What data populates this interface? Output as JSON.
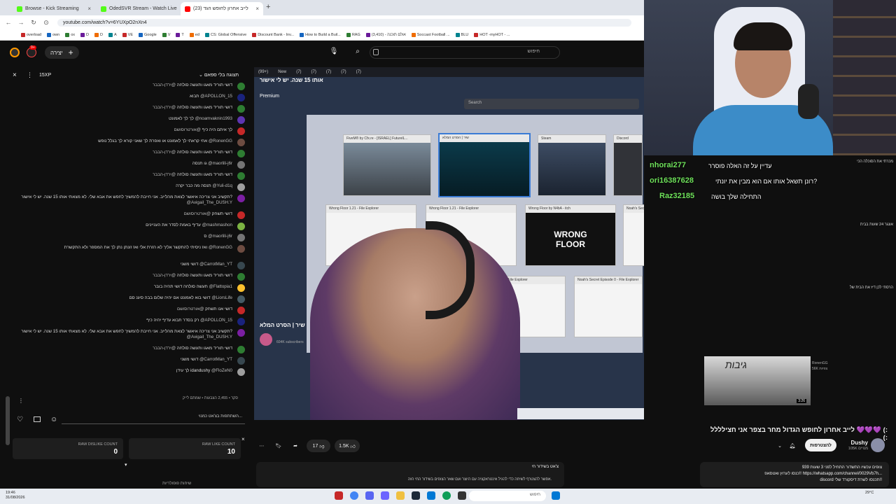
{
  "browser": {
    "tabs": [
      {
        "title": "Browse - Kick Streaming",
        "color": "#53fc18"
      },
      {
        "title": "OdedSVR Stream - Watch Live",
        "color": "#53fc18"
      },
      {
        "title": "לייב אחרון לחופש הגד (23)",
        "color": "#ff0000"
      }
    ],
    "new_tab": "+",
    "url": "youtube.com/watch?v=6YUXpO2nXn4",
    "bookmarks": [
      "overload",
      "own",
      "ox",
      "D",
      "D",
      "A",
      "VE",
      "Google",
      "V",
      "T",
      "ed",
      "CS: Global Offensive",
      "Discount Bank - Inv...",
      "How to Build a Buil...",
      "RAG",
      "(3,410) - אולם תוכנה",
      "Soccast Football ...",
      "BLU",
      "HOT -myHOT - ..."
    ]
  },
  "yt_header": {
    "create_label": "יצירה",
    "notif_count": "9+",
    "search_placeholder": "חיפוש"
  },
  "chat": {
    "header_title": "תצוגה בלי ספאם",
    "xp_badge": "15XP",
    "messages": [
      {
        "user": "@ירדן-הבבר",
        "text": "דושי תוריד מאגו ותעשה סולחה",
        "color": "#2e7d32"
      },
      {
        "user": "@APOLLON_15",
        "text": "תבוא",
        "color": "#1a237e"
      },
      {
        "user": "@ירדן-הבבר",
        "text": "דושי תוריד מאגו ותעשה סולחה",
        "color": "#2e7d32"
      },
      {
        "user": "@noamvaknin1993",
        "text": "לך לך לאמונט",
        "color": "#5e35b1"
      },
      {
        "user": "@אורטרוסושם",
        "text": "לך איתם היה כיף",
        "color": "#c62828"
      },
      {
        "user": "@RonenGG",
        "text": "אחי קראתי לך לאמונט או ואפרת לך שאני קורא לך בגלל נופש",
        "color": "#6d4c41"
      },
      {
        "user": "@ירדן-הבבר",
        "text": "דושי תוריד מאגו ותעשה סולחה",
        "color": "#2e7d32"
      },
      {
        "user": "@maorlili-j6r",
        "text": "גו תנסה",
        "color": "#757575"
      },
      {
        "user": "@ירדן-הבבר",
        "text": "דושי תוריד מאגו ותעשה סולחה",
        "color": "#2e7d32"
      },
      {
        "user": "@Yuli-d1q",
        "text": "תנסה מה כבר יקרה",
        "color": "#9e9e9e"
      },
      {
        "user": "@Avigail_The_DUSH.Y",
        "text": "תקשיב אני צריכה איאשר לצאת מהלייב. אני חייבת להמשיך לחפש את אבא שלי. לא מצאתי אותו 15 שנה. יש לי אישור?",
        "color": "#7b1fa2"
      },
      {
        "user": "@אורטרוסושם",
        "text": "דושי תשחק",
        "color": "#c62828"
      },
      {
        "user": "@mashmashon",
        "text": "עדיף באמת לסדר את העניינים",
        "color": "#7cb342"
      },
      {
        "user": "@maorlili-j6r",
        "text": "ס",
        "color": "#757575"
      },
      {
        "user": "@RonenGG",
        "text": "ואז ניסיתי להתקשר אליך לא הזרת אלי ואז זונתן נתן לך את המספר ולא התקשרת",
        "color": "#6d4c41"
      },
      {
        "user": "@CarrotMan_YT",
        "text": "דושי משני",
        "color": "#37474f"
      },
      {
        "user": "@ירדן-הבבר",
        "text": "דושי תוריד מאגו ותעשה סולחה",
        "color": "#2e7d32"
      },
      {
        "user": "@Flattopia1",
        "text": "תעשה סולחה דושי תהיה בובר",
        "color": "#fbc02d"
      },
      {
        "user": "@LiorsLife",
        "text": "דושי בוא לאמונט אם יהיה שלום בבה סיגנ סם",
        "color": "#455a64"
      },
      {
        "user": "@אורטרוסושם",
        "text": "דושי אנו תשחק",
        "color": "#c62828"
      },
      {
        "user": "@APOLLON_15",
        "text": "רק בסדר תבוא עדיף יהיה כיף",
        "color": "#1a237e"
      },
      {
        "user": "@Avigail_The_DUSH.Y",
        "text": "תקשיב אני צריכה איאשר לצאת מהלייב. אני חייבת להמשיך לחפש את אבא שלי. לא מצאתי אותו 15 שנה. יש לי אישור?",
        "color": "#7b1fa2"
      },
      {
        "user": "@ירדן-הבבר",
        "text": "דושי תוריד מאגו ותעשה סולחה",
        "color": "#2e7d32"
      },
      {
        "user": "@CarrotMan_YT",
        "text": "דושי משני",
        "color": "#37474f"
      },
      {
        "user": "@FloZeN0",
        "text": "לך עידן idandushy",
        "color": "#9e9e9e"
      }
    ],
    "footer_stats": "סקר • 2,455 הצבעות • שמתם לייק",
    "input_placeholder": "השתתפות בצ'אט כמנוי..."
  },
  "counters": {
    "dislike_label": "RAW DISLIKE COUNT",
    "dislike_value": "0",
    "like_label": "RAW LIKE COUNT",
    "like_value": "10"
  },
  "video": {
    "overlay_title": "אותו 15 שנה. יש לי אישור",
    "tab_labels": [
      "(99+)",
      "New",
      "(7)",
      "(7)",
      "(7)",
      "(7)",
      "(7)"
    ],
    "search_label": "Search",
    "premium_label": "Premium",
    "windows": [
      "FiveM® by Cfx.re - [ISRAEL] FuturelL...",
      "Steam",
      "Discord",
      "Wrong Floor 1.21 - File Explorer",
      "Wrong Floor 1.21 - File Explorer",
      "Wrong Floor by N4bA - itch",
      "Noah's Secret Episode 0 - File Explorer",
      "Noah's Secret Episode 0 - File Explorer",
      "StillWithMeDemo - File Explorer",
      "Noah's Secret Episode 0 - File Explorer",
      "Noah's Secret Episode 0 - File Explorer"
    ],
    "wrong_floor_text": "WRONG FLOOR",
    "inner_channel": "604K subscribers",
    "inner_video_title": "שיר | הסרט המלא"
  },
  "overlay_chat": [
    {
      "user": "nhorai277",
      "text": "עדיין על זה האלה פוסרר"
    },
    {
      "user": "ori16387628",
      "text": "רונן תשאל אותו אם הוא מבין את יונתי?"
    },
    {
      "user": "Raz32185",
      "text": "התחילה שלך בושה"
    }
  ],
  "video_info": {
    "title": "לייב אחרון לחופש הגדול מחר בצפר אני חצילללל 💜💜💜 (:(:",
    "channel": "Dushy",
    "subs": "105K מנויים",
    "subscribe_label": "להצטרפות",
    "like_count": "1.5K",
    "dislike_count": "17",
    "desc_line1": "939 צופים עכשיו התשדור התחיל לפני 3 שעות",
    "desc_line2": "כנסו לערוץ ואטסאפ!! https://whatsapp.com/channel/0029Vb7h...",
    "desc_line3": "discord תכנסו לשרת דיסקורד שלי!!",
    "description_right": "צ'אט בשידור חי",
    "chat_note": "אפשר להצטרף לשיחה כדי להגיל אינטראקציה עם היוצר ועם שאר הצופים בשידור החי הזה.",
    "sort_label": "שיחות פופולריות"
  },
  "right_column": {
    "item1": "מכרתי את הסוכלה הכי",
    "item2": "אונגר 24 שעות בבית",
    "item3": "הרסתי לכן דיז את הבית של",
    "thumb_text": "גיבות",
    "thumb_duration": "3:26",
    "thumb_channel": "RonenGG",
    "thumb_meta": "56K צפיות"
  },
  "taskbar": {
    "time": "19:46",
    "date": "31/08/2026",
    "search_placeholder": "חיפוש",
    "weather": "29°C"
  }
}
